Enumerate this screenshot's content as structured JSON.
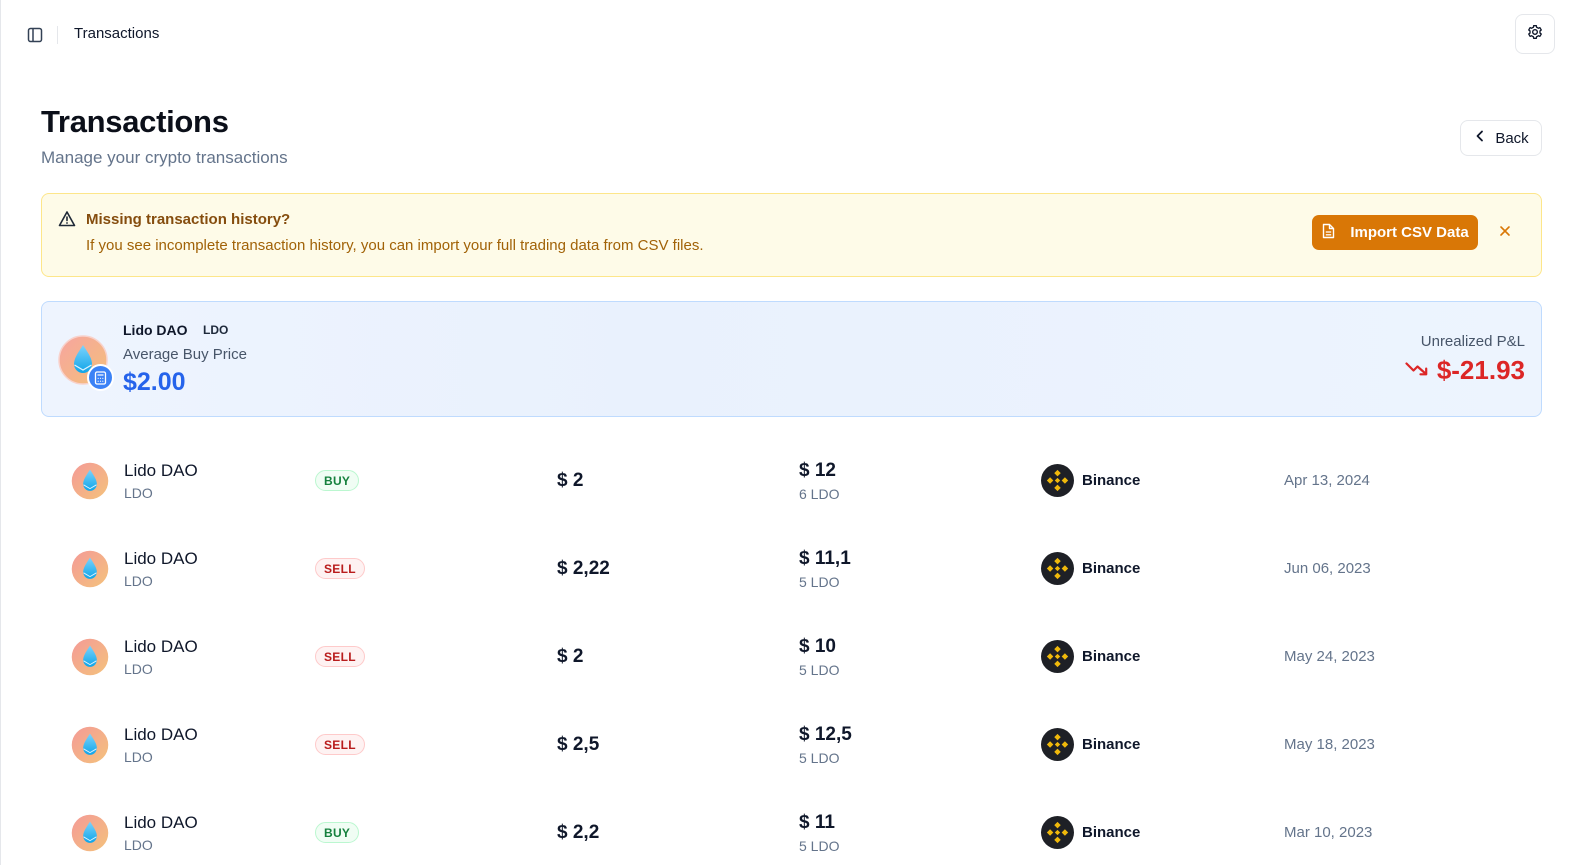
{
  "topbar": {
    "breadcrumb": "Transactions"
  },
  "header": {
    "title": "Transactions",
    "subtitle": "Manage your crypto transactions",
    "back_label": "Back"
  },
  "alert": {
    "title": "Missing transaction history?",
    "text": "If you see incomplete transaction history, you can import your full trading data from CSV files.",
    "import_label": "Import CSV Data"
  },
  "summary": {
    "asset_name": "Lido DAO",
    "asset_symbol": "LDO",
    "avg_label": "Average Buy Price",
    "avg_price": "$2.00",
    "pnl_label": "Unrealized P&L",
    "pnl_value": "$-21.93"
  },
  "colors": {
    "accent_blue": "#2563eb",
    "loss_red": "#dc2626",
    "warning_orange": "#d97706",
    "binance_yellow": "#f0b90b"
  },
  "transactions": [
    {
      "name": "Lido DAO",
      "symbol": "LDO",
      "type": "BUY",
      "price": "$ 2",
      "total": "$ 12",
      "qty": "6 LDO",
      "exchange": "Binance",
      "date": "Apr 13, 2024"
    },
    {
      "name": "Lido DAO",
      "symbol": "LDO",
      "type": "SELL",
      "price": "$ 2,22",
      "total": "$ 11,1",
      "qty": "5 LDO",
      "exchange": "Binance",
      "date": "Jun 06, 2023"
    },
    {
      "name": "Lido DAO",
      "symbol": "LDO",
      "type": "SELL",
      "price": "$ 2",
      "total": "$ 10",
      "qty": "5 LDO",
      "exchange": "Binance",
      "date": "May 24, 2023"
    },
    {
      "name": "Lido DAO",
      "symbol": "LDO",
      "type": "SELL",
      "price": "$ 2,5",
      "total": "$ 12,5",
      "qty": "5 LDO",
      "exchange": "Binance",
      "date": "May 18, 2023"
    },
    {
      "name": "Lido DAO",
      "symbol": "LDO",
      "type": "BUY",
      "price": "$ 2,2",
      "total": "$ 11",
      "qty": "5 LDO",
      "exchange": "Binance",
      "date": "Mar 10, 2023"
    }
  ]
}
